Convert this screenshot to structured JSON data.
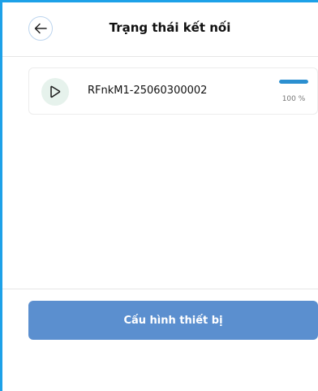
{
  "header": {
    "title": "Trạng thái kết nối",
    "back_icon": "arrow-left-icon"
  },
  "device": {
    "icon": "play-icon",
    "name": "RFnkM1-25060300002",
    "progress_percent": 100,
    "progress_label": "100 %"
  },
  "footer": {
    "config_button_label": "Cấu hình thiết bị"
  },
  "colors": {
    "frame_accent": "#1da1e8",
    "progress_fill": "#2b8fd0",
    "button_bg": "#5b8fcf",
    "device_icon_bg": "#e6f2ec"
  }
}
